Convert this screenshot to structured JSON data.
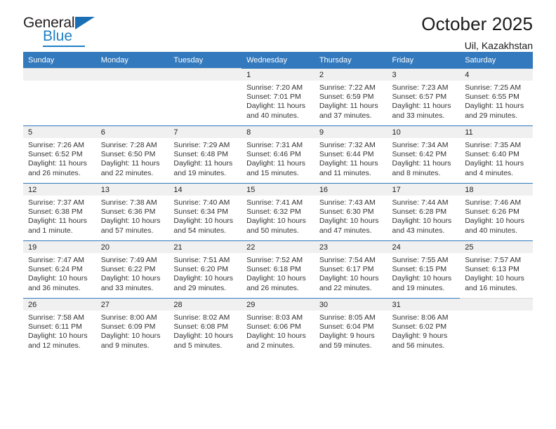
{
  "brand": {
    "name_top": "General",
    "name_bottom": "Blue",
    "accent_color": "#1f7fc4"
  },
  "header": {
    "title": "October 2025",
    "subtitle": "Uil, Kazakhstan"
  },
  "calendar": {
    "header_color": "#3379bd",
    "weekday_headers": [
      "Sunday",
      "Monday",
      "Tuesday",
      "Wednesday",
      "Thursday",
      "Friday",
      "Saturday"
    ],
    "weeks": [
      [
        {
          "day": "",
          "sunrise": "",
          "sunset": "",
          "daylight": "",
          "empty": true
        },
        {
          "day": "",
          "sunrise": "",
          "sunset": "",
          "daylight": "",
          "empty": true
        },
        {
          "day": "",
          "sunrise": "",
          "sunset": "",
          "daylight": "",
          "empty": true
        },
        {
          "day": "1",
          "sunrise": "Sunrise: 7:20 AM",
          "sunset": "Sunset: 7:01 PM",
          "daylight": "Daylight: 11 hours and 40 minutes.",
          "empty": false
        },
        {
          "day": "2",
          "sunrise": "Sunrise: 7:22 AM",
          "sunset": "Sunset: 6:59 PM",
          "daylight": "Daylight: 11 hours and 37 minutes.",
          "empty": false
        },
        {
          "day": "3",
          "sunrise": "Sunrise: 7:23 AM",
          "sunset": "Sunset: 6:57 PM",
          "daylight": "Daylight: 11 hours and 33 minutes.",
          "empty": false
        },
        {
          "day": "4",
          "sunrise": "Sunrise: 7:25 AM",
          "sunset": "Sunset: 6:55 PM",
          "daylight": "Daylight: 11 hours and 29 minutes.",
          "empty": false
        }
      ],
      [
        {
          "day": "5",
          "sunrise": "Sunrise: 7:26 AM",
          "sunset": "Sunset: 6:52 PM",
          "daylight": "Daylight: 11 hours and 26 minutes.",
          "empty": false
        },
        {
          "day": "6",
          "sunrise": "Sunrise: 7:28 AM",
          "sunset": "Sunset: 6:50 PM",
          "daylight": "Daylight: 11 hours and 22 minutes.",
          "empty": false
        },
        {
          "day": "7",
          "sunrise": "Sunrise: 7:29 AM",
          "sunset": "Sunset: 6:48 PM",
          "daylight": "Daylight: 11 hours and 19 minutes.",
          "empty": false
        },
        {
          "day": "8",
          "sunrise": "Sunrise: 7:31 AM",
          "sunset": "Sunset: 6:46 PM",
          "daylight": "Daylight: 11 hours and 15 minutes.",
          "empty": false
        },
        {
          "day": "9",
          "sunrise": "Sunrise: 7:32 AM",
          "sunset": "Sunset: 6:44 PM",
          "daylight": "Daylight: 11 hours and 11 minutes.",
          "empty": false
        },
        {
          "day": "10",
          "sunrise": "Sunrise: 7:34 AM",
          "sunset": "Sunset: 6:42 PM",
          "daylight": "Daylight: 11 hours and 8 minutes.",
          "empty": false
        },
        {
          "day": "11",
          "sunrise": "Sunrise: 7:35 AM",
          "sunset": "Sunset: 6:40 PM",
          "daylight": "Daylight: 11 hours and 4 minutes.",
          "empty": false
        }
      ],
      [
        {
          "day": "12",
          "sunrise": "Sunrise: 7:37 AM",
          "sunset": "Sunset: 6:38 PM",
          "daylight": "Daylight: 11 hours and 1 minute.",
          "empty": false
        },
        {
          "day": "13",
          "sunrise": "Sunrise: 7:38 AM",
          "sunset": "Sunset: 6:36 PM",
          "daylight": "Daylight: 10 hours and 57 minutes.",
          "empty": false
        },
        {
          "day": "14",
          "sunrise": "Sunrise: 7:40 AM",
          "sunset": "Sunset: 6:34 PM",
          "daylight": "Daylight: 10 hours and 54 minutes.",
          "empty": false
        },
        {
          "day": "15",
          "sunrise": "Sunrise: 7:41 AM",
          "sunset": "Sunset: 6:32 PM",
          "daylight": "Daylight: 10 hours and 50 minutes.",
          "empty": false
        },
        {
          "day": "16",
          "sunrise": "Sunrise: 7:43 AM",
          "sunset": "Sunset: 6:30 PM",
          "daylight": "Daylight: 10 hours and 47 minutes.",
          "empty": false
        },
        {
          "day": "17",
          "sunrise": "Sunrise: 7:44 AM",
          "sunset": "Sunset: 6:28 PM",
          "daylight": "Daylight: 10 hours and 43 minutes.",
          "empty": false
        },
        {
          "day": "18",
          "sunrise": "Sunrise: 7:46 AM",
          "sunset": "Sunset: 6:26 PM",
          "daylight": "Daylight: 10 hours and 40 minutes.",
          "empty": false
        }
      ],
      [
        {
          "day": "19",
          "sunrise": "Sunrise: 7:47 AM",
          "sunset": "Sunset: 6:24 PM",
          "daylight": "Daylight: 10 hours and 36 minutes.",
          "empty": false
        },
        {
          "day": "20",
          "sunrise": "Sunrise: 7:49 AM",
          "sunset": "Sunset: 6:22 PM",
          "daylight": "Daylight: 10 hours and 33 minutes.",
          "empty": false
        },
        {
          "day": "21",
          "sunrise": "Sunrise: 7:51 AM",
          "sunset": "Sunset: 6:20 PM",
          "daylight": "Daylight: 10 hours and 29 minutes.",
          "empty": false
        },
        {
          "day": "22",
          "sunrise": "Sunrise: 7:52 AM",
          "sunset": "Sunset: 6:18 PM",
          "daylight": "Daylight: 10 hours and 26 minutes.",
          "empty": false
        },
        {
          "day": "23",
          "sunrise": "Sunrise: 7:54 AM",
          "sunset": "Sunset: 6:17 PM",
          "daylight": "Daylight: 10 hours and 22 minutes.",
          "empty": false
        },
        {
          "day": "24",
          "sunrise": "Sunrise: 7:55 AM",
          "sunset": "Sunset: 6:15 PM",
          "daylight": "Daylight: 10 hours and 19 minutes.",
          "empty": false
        },
        {
          "day": "25",
          "sunrise": "Sunrise: 7:57 AM",
          "sunset": "Sunset: 6:13 PM",
          "daylight": "Daylight: 10 hours and 16 minutes.",
          "empty": false
        }
      ],
      [
        {
          "day": "26",
          "sunrise": "Sunrise: 7:58 AM",
          "sunset": "Sunset: 6:11 PM",
          "daylight": "Daylight: 10 hours and 12 minutes.",
          "empty": false
        },
        {
          "day": "27",
          "sunrise": "Sunrise: 8:00 AM",
          "sunset": "Sunset: 6:09 PM",
          "daylight": "Daylight: 10 hours and 9 minutes.",
          "empty": false
        },
        {
          "day": "28",
          "sunrise": "Sunrise: 8:02 AM",
          "sunset": "Sunset: 6:08 PM",
          "daylight": "Daylight: 10 hours and 5 minutes.",
          "empty": false
        },
        {
          "day": "29",
          "sunrise": "Sunrise: 8:03 AM",
          "sunset": "Sunset: 6:06 PM",
          "daylight": "Daylight: 10 hours and 2 minutes.",
          "empty": false
        },
        {
          "day": "30",
          "sunrise": "Sunrise: 8:05 AM",
          "sunset": "Sunset: 6:04 PM",
          "daylight": "Daylight: 9 hours and 59 minutes.",
          "empty": false
        },
        {
          "day": "31",
          "sunrise": "Sunrise: 8:06 AM",
          "sunset": "Sunset: 6:02 PM",
          "daylight": "Daylight: 9 hours and 56 minutes.",
          "empty": false
        },
        {
          "day": "",
          "sunrise": "",
          "sunset": "",
          "daylight": "",
          "empty": true
        }
      ]
    ]
  }
}
